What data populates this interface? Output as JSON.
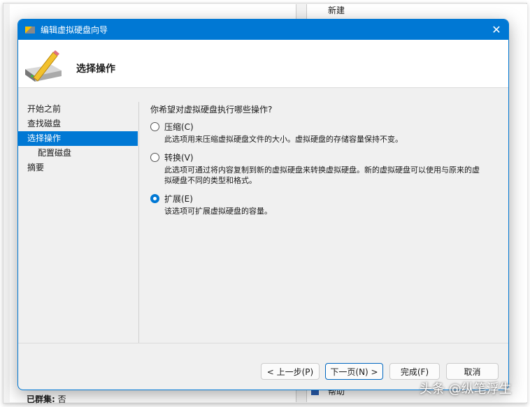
{
  "background": {
    "new_label": "新建",
    "help_label": "帮助",
    "clustered_label": "已群集:",
    "clustered_value": "否"
  },
  "dialog": {
    "title": "编辑虚拟硬盘向导",
    "page_title": "选择操作",
    "nav": [
      "开始之前",
      "查找磁盘",
      "选择操作",
      "配置磁盘",
      "摘要"
    ],
    "question": "你希望对虚拟硬盘执行哪些操作?",
    "options": [
      {
        "label": "压缩(C)",
        "desc": "此选项用来压缩虚拟硬盘文件的大小。虚拟硬盘的存储容量保持不变。",
        "selected": false
      },
      {
        "label": "转换(V)",
        "desc": "此选项可通过将内容复制到新的虚拟硬盘来转换虚拟硬盘。新的虚拟硬盘可以使用与原来的虚拟硬盘不同的类型和格式。",
        "selected": false
      },
      {
        "label": "扩展(E)",
        "desc": "该选项可扩展虚拟硬盘的容量。",
        "selected": true
      }
    ],
    "buttons": {
      "prev": "< 上一步(P)",
      "next": "下一页(N) >",
      "finish": "完成(F)",
      "cancel": "取消"
    }
  },
  "watermark": "头条 @纵笔浮生"
}
